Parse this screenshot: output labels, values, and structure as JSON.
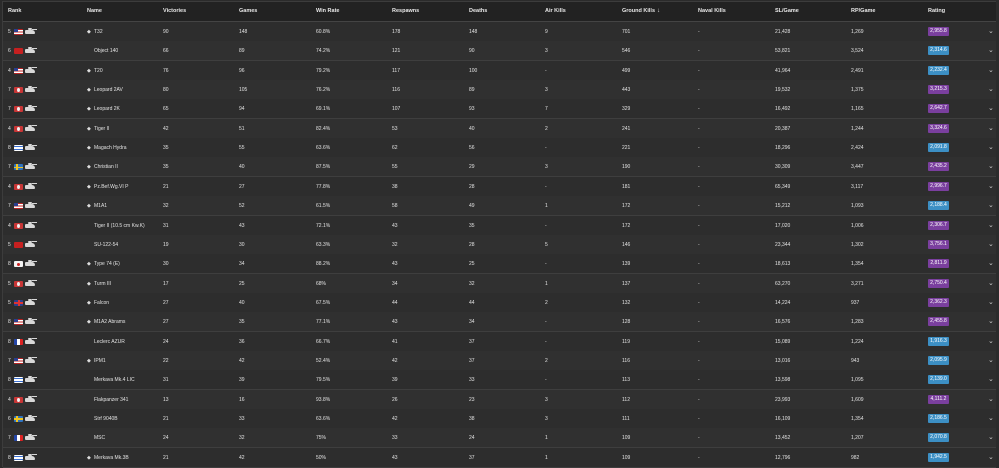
{
  "table": {
    "headers": {
      "rank": "Rank",
      "name": "Name",
      "victories": "Victories",
      "games": "Games",
      "win_rate": "Win Rate",
      "respawns": "Respawns",
      "deaths": "Deaths",
      "air_kills": "Air Kills",
      "ground_kills": "Ground Kills",
      "sort_indicator": "↓",
      "naval_kills": "Naval Kills",
      "sl_game": "SL/Game",
      "rp_game": "RP/Game",
      "rating": "Rating"
    },
    "colors": {
      "rating_purple": "#7a3f9e",
      "rating_blue": "#3c8fc4",
      "row_border": "#3e3e3e",
      "header_bg": "#222222"
    },
    "rows": [
      {
        "rank": "5",
        "nation": "us",
        "vehicle_marker": "◆",
        "name": "T32",
        "victories": "90",
        "games": "148",
        "win_rate": "60.8%",
        "respawns": "178",
        "deaths": "148",
        "air_kills": "9",
        "ground_kills": "701",
        "naval_kills": "-",
        "sl_game": "21,428",
        "rp_game": "1,269",
        "rating": "2,955.8",
        "rating_color": "purple"
      },
      {
        "rank": "6",
        "nation": "ussr",
        "vehicle_marker": "",
        "name": "Object 140",
        "victories": "66",
        "games": "89",
        "win_rate": "74.2%",
        "respawns": "121",
        "deaths": "90",
        "air_kills": "3",
        "ground_kills": "546",
        "naval_kills": "-",
        "sl_game": "53,821",
        "rp_game": "3,524",
        "rating": "2,314.6",
        "rating_color": "blue"
      },
      {
        "rank": "4",
        "nation": "us",
        "vehicle_marker": "◆",
        "name": "T20",
        "victories": "76",
        "games": "96",
        "win_rate": "79.2%",
        "respawns": "117",
        "deaths": "100",
        "air_kills": "-",
        "ground_kills": "499",
        "naval_kills": "-",
        "sl_game": "41,964",
        "rp_game": "2,491",
        "rating": "2,232.4",
        "rating_color": "blue"
      },
      {
        "rank": "7",
        "nation": "de",
        "vehicle_marker": "◆",
        "name": "Leopard 2AV",
        "victories": "80",
        "games": "105",
        "win_rate": "76.2%",
        "respawns": "116",
        "deaths": "89",
        "air_kills": "3",
        "ground_kills": "443",
        "naval_kills": "-",
        "sl_game": "19,532",
        "rp_game": "1,375",
        "rating": "3,215.3",
        "rating_color": "purple"
      },
      {
        "rank": "7",
        "nation": "de",
        "vehicle_marker": "◆",
        "name": "Leopard 2K",
        "victories": "65",
        "games": "94",
        "win_rate": "69.1%",
        "respawns": "107",
        "deaths": "93",
        "air_kills": "7",
        "ground_kills": "329",
        "naval_kills": "-",
        "sl_game": "16,492",
        "rp_game": "1,165",
        "rating": "2,642.7",
        "rating_color": "purple"
      },
      {
        "rank": "4",
        "nation": "de",
        "vehicle_marker": "◆",
        "name": "Tiger II",
        "victories": "42",
        "games": "51",
        "win_rate": "82.4%",
        "respawns": "53",
        "deaths": "40",
        "air_kills": "2",
        "ground_kills": "241",
        "naval_kills": "-",
        "sl_game": "20,387",
        "rp_game": "1,244",
        "rating": "3,324.6",
        "rating_color": "purple"
      },
      {
        "rank": "8",
        "nation": "il",
        "vehicle_marker": "◆",
        "name": "Magach Hydra",
        "victories": "35",
        "games": "55",
        "win_rate": "63.6%",
        "respawns": "62",
        "deaths": "56",
        "air_kills": "-",
        "ground_kills": "221",
        "naval_kills": "-",
        "sl_game": "18,296",
        "rp_game": "2,424",
        "rating": "2,091.8",
        "rating_color": "blue"
      },
      {
        "rank": "7",
        "nation": "se",
        "vehicle_marker": "◆",
        "name": "Christian II",
        "victories": "35",
        "games": "40",
        "win_rate": "87.5%",
        "respawns": "55",
        "deaths": "29",
        "air_kills": "3",
        "ground_kills": "190",
        "naval_kills": "-",
        "sl_game": "30,309",
        "rp_game": "3,447",
        "rating": "2,435.2",
        "rating_color": "purple"
      },
      {
        "rank": "4",
        "nation": "de",
        "vehicle_marker": "◆",
        "name": "Pz.Bef.Wg.VI P",
        "victories": "21",
        "games": "27",
        "win_rate": "77.8%",
        "respawns": "38",
        "deaths": "28",
        "air_kills": "-",
        "ground_kills": "181",
        "naval_kills": "-",
        "sl_game": "65,349",
        "rp_game": "3,117",
        "rating": "2,996.7",
        "rating_color": "purple"
      },
      {
        "rank": "7",
        "nation": "us",
        "vehicle_marker": "◆",
        "name": "M1A1",
        "victories": "32",
        "games": "52",
        "win_rate": "61.5%",
        "respawns": "58",
        "deaths": "49",
        "air_kills": "1",
        "ground_kills": "172",
        "naval_kills": "-",
        "sl_game": "15,212",
        "rp_game": "1,093",
        "rating": "2,188.4",
        "rating_color": "blue"
      },
      {
        "rank": "4",
        "nation": "de",
        "vehicle_marker": "",
        "name": "Tiger II (10.5 cm Kw.K)",
        "victories": "31",
        "games": "43",
        "win_rate": "72.1%",
        "respawns": "43",
        "deaths": "35",
        "air_kills": "-",
        "ground_kills": "172",
        "naval_kills": "-",
        "sl_game": "17,020",
        "rp_game": "1,006",
        "rating": "2,306.7",
        "rating_color": "purple"
      },
      {
        "rank": "5",
        "nation": "ussr",
        "vehicle_marker": "",
        "name": "SU-122-54",
        "victories": "19",
        "games": "30",
        "win_rate": "63.3%",
        "respawns": "32",
        "deaths": "28",
        "air_kills": "5",
        "ground_kills": "146",
        "naval_kills": "-",
        "sl_game": "23,344",
        "rp_game": "1,302",
        "rating": "3,756.1",
        "rating_color": "purple"
      },
      {
        "rank": "8",
        "nation": "jp",
        "vehicle_marker": "◆",
        "name": "Type 74 (E)",
        "victories": "30",
        "games": "34",
        "win_rate": "88.2%",
        "respawns": "43",
        "deaths": "25",
        "air_kills": "-",
        "ground_kills": "139",
        "naval_kills": "-",
        "sl_game": "18,613",
        "rp_game": "1,354",
        "rating": "2,811.9",
        "rating_color": "purple"
      },
      {
        "rank": "5",
        "nation": "de",
        "vehicle_marker": "◆",
        "name": "Turm III",
        "victories": "17",
        "games": "25",
        "win_rate": "68%",
        "respawns": "34",
        "deaths": "32",
        "air_kills": "1",
        "ground_kills": "137",
        "naval_kills": "-",
        "sl_game": "63,270",
        "rp_game": "3,271",
        "rating": "2,750.4",
        "rating_color": "purple"
      },
      {
        "rank": "5",
        "nation": "uk",
        "vehicle_marker": "◆",
        "name": "Falcon",
        "victories": "27",
        "games": "40",
        "win_rate": "67.5%",
        "respawns": "44",
        "deaths": "44",
        "air_kills": "2",
        "ground_kills": "132",
        "naval_kills": "-",
        "sl_game": "14,224",
        "rp_game": "937",
        "rating": "2,362.3",
        "rating_color": "purple"
      },
      {
        "rank": "8",
        "nation": "us",
        "vehicle_marker": "◆",
        "name": "M1A2 Abrams",
        "victories": "27",
        "games": "35",
        "win_rate": "77.1%",
        "respawns": "43",
        "deaths": "34",
        "air_kills": "-",
        "ground_kills": "128",
        "naval_kills": "-",
        "sl_game": "16,576",
        "rp_game": "1,283",
        "rating": "2,455.8",
        "rating_color": "purple"
      },
      {
        "rank": "8",
        "nation": "fr",
        "vehicle_marker": "",
        "name": "Leclerc AZUR",
        "victories": "24",
        "games": "36",
        "win_rate": "66.7%",
        "respawns": "41",
        "deaths": "37",
        "air_kills": "-",
        "ground_kills": "119",
        "naval_kills": "-",
        "sl_game": "15,089",
        "rp_game": "1,224",
        "rating": "1,916.3",
        "rating_color": "blue"
      },
      {
        "rank": "7",
        "nation": "us",
        "vehicle_marker": "◆",
        "name": "IPM1",
        "victories": "22",
        "games": "42",
        "win_rate": "52.4%",
        "respawns": "42",
        "deaths": "37",
        "air_kills": "2",
        "ground_kills": "116",
        "naval_kills": "-",
        "sl_game": "13,016",
        "rp_game": "943",
        "rating": "2,095.9",
        "rating_color": "blue"
      },
      {
        "rank": "8",
        "nation": "il",
        "vehicle_marker": "",
        "name": "Merkava Mk.4 LIC",
        "victories": "31",
        "games": "39",
        "win_rate": "79.5%",
        "respawns": "39",
        "deaths": "33",
        "air_kills": "-",
        "ground_kills": "113",
        "naval_kills": "-",
        "sl_game": "13,598",
        "rp_game": "1,095",
        "rating": "2,139.0",
        "rating_color": "blue"
      },
      {
        "rank": "4",
        "nation": "de",
        "vehicle_marker": "",
        "name": "Flakpanzer 341",
        "victories": "13",
        "games": "16",
        "win_rate": "93.8%",
        "respawns": "26",
        "deaths": "23",
        "air_kills": "3",
        "ground_kills": "112",
        "naval_kills": "-",
        "sl_game": "23,993",
        "rp_game": "1,609",
        "rating": "4,111.2",
        "rating_color": "purple"
      },
      {
        "rank": "6",
        "nation": "se",
        "vehicle_marker": "",
        "name": "Strf 9040B",
        "victories": "21",
        "games": "33",
        "win_rate": "63.6%",
        "respawns": "42",
        "deaths": "38",
        "air_kills": "3",
        "ground_kills": "111",
        "naval_kills": "-",
        "sl_game": "16,109",
        "rp_game": "1,354",
        "rating": "2,186.5",
        "rating_color": "blue"
      },
      {
        "rank": "7",
        "nation": "fr",
        "vehicle_marker": "",
        "name": "MSC",
        "victories": "24",
        "games": "32",
        "win_rate": "75%",
        "respawns": "33",
        "deaths": "24",
        "air_kills": "1",
        "ground_kills": "109",
        "naval_kills": "-",
        "sl_game": "13,452",
        "rp_game": "1,207",
        "rating": "2,070.8",
        "rating_color": "blue"
      },
      {
        "rank": "8",
        "nation": "il",
        "vehicle_marker": "◆",
        "name": "Merkava Mk.3B",
        "victories": "21",
        "games": "42",
        "win_rate": "50%",
        "respawns": "43",
        "deaths": "37",
        "air_kills": "1",
        "ground_kills": "109",
        "naval_kills": "-",
        "sl_game": "12,796",
        "rp_game": "982",
        "rating": "1,942.5",
        "rating_color": "blue"
      }
    ]
  },
  "icons": {
    "row_expand": "chevron-down-icon",
    "nation_flag": "flag-icon",
    "vehicle_type": "tank-icon",
    "premium_marker": "premium-marker-icon"
  }
}
